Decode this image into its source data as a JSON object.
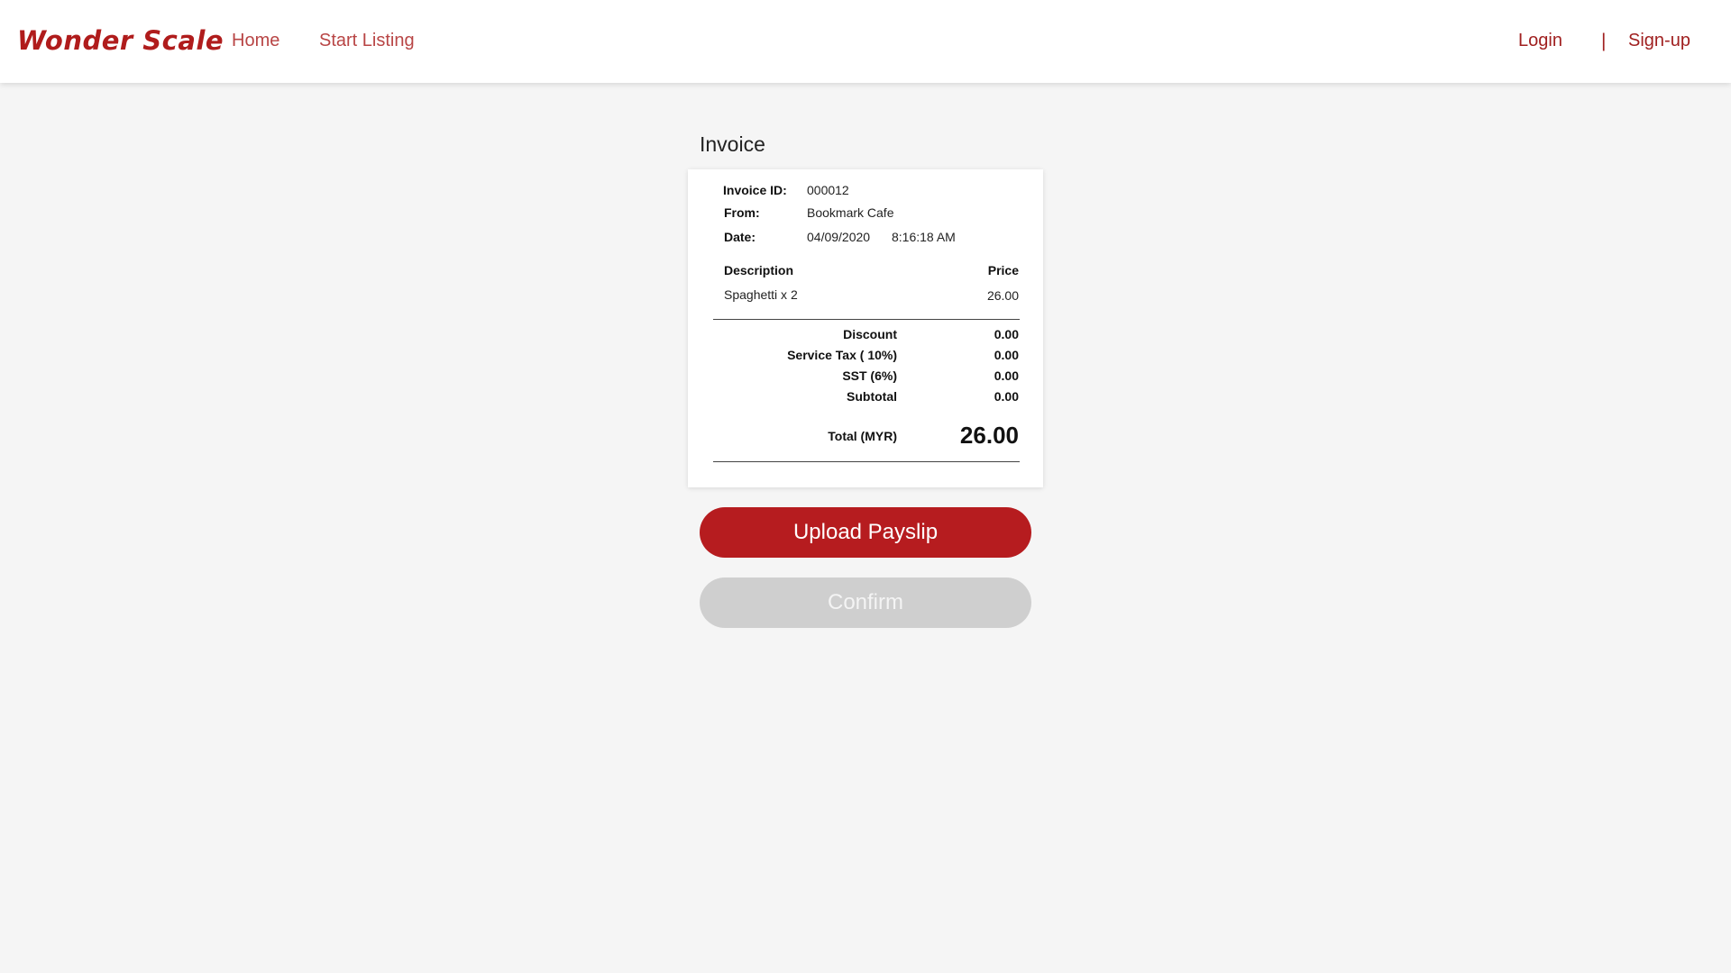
{
  "brand": {
    "logo_text": "Wonder Scale",
    "accent_color": "#b61c1f"
  },
  "nav": {
    "home": "Home",
    "start_listing": "Start Listing",
    "login": "Login",
    "separator": "|",
    "signup": "Sign-up"
  },
  "invoice": {
    "heading": "Invoice",
    "id_label": "Invoice ID:",
    "id_value": "000012",
    "from_label": "From:",
    "from_value": "Bookmark Cafe",
    "date_label": "Date:",
    "date_value": "04/09/2020",
    "time_value": "8:16:18 AM",
    "col_description": "Description",
    "col_price": "Price",
    "items": [
      {
        "description": "Spaghetti x 2",
        "price": "26.00"
      }
    ],
    "summary": [
      {
        "label": "Discount",
        "value": "0.00"
      },
      {
        "label": "Service Tax ( 10%)",
        "value": "0.00"
      },
      {
        "label": "SST (6%)",
        "value": "0.00"
      },
      {
        "label": "Subtotal",
        "value": "0.00"
      }
    ],
    "total_label": "Total (MYR)",
    "total_value": "26.00"
  },
  "actions": {
    "upload_label": "Upload Payslip",
    "confirm_label": "Confirm",
    "confirm_disabled": true
  }
}
